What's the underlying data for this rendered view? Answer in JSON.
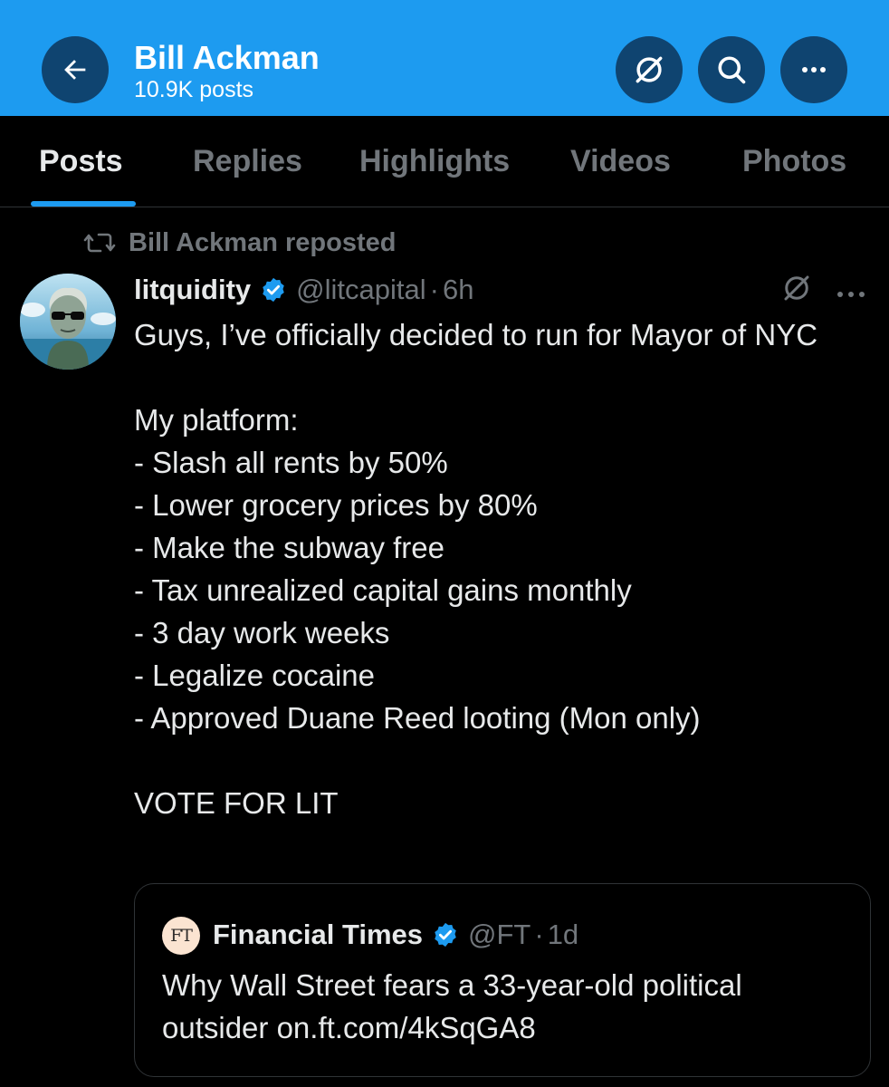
{
  "header": {
    "name": "Bill Ackman",
    "posts_count": "10.9K posts",
    "background": "#1d9bf0"
  },
  "tabs": [
    {
      "label": "Posts",
      "active": true
    },
    {
      "label": "Replies",
      "active": false
    },
    {
      "label": "Highlights",
      "active": false
    },
    {
      "label": "Videos",
      "active": false
    },
    {
      "label": "Photos",
      "active": false
    }
  ],
  "repost": {
    "icon": "repost-icon",
    "text": "Bill Ackman reposted"
  },
  "post": {
    "author": "litquidity",
    "handle": "@litcapital",
    "separator": "·",
    "time": "6h",
    "verified": true,
    "lines": [
      "Guys, I’ve officially decided to run for Mayor of NYC",
      "",
      "My platform:",
      "- Slash all rents by 50%",
      "- Lower grocery prices by 80%",
      "- Make the subway free",
      "- Tax unrealized capital gains monthly",
      "- 3 day work weeks",
      "- Legalize cocaine",
      "- Approved Duane Reed looting (Mon only)",
      "",
      "VOTE FOR LIT"
    ]
  },
  "quote": {
    "logo_text": "FT",
    "author": "Financial Times",
    "handle": "@FT",
    "separator": "·",
    "time": "1d",
    "verified": true,
    "text": "Why Wall Street fears a 33-year-old political outsider on.ft.com/4kSqGA8"
  },
  "colors": {
    "accent": "#1d9bf0",
    "muted": "#71767b",
    "text": "#e7e9ea",
    "background": "#000000",
    "border": "#2f3336"
  }
}
